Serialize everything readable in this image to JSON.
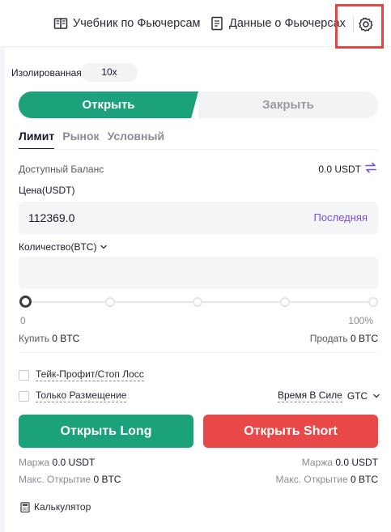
{
  "header": {
    "tutorial_label": "Учебник по Фьючерсам",
    "data_label": "Данные о Фьючерсах"
  },
  "margin": {
    "mode_label": "Изолированная",
    "leverage": "10x"
  },
  "side": {
    "open_label": "Открыть",
    "close_label": "Закрыть"
  },
  "order_tabs": [
    "Лимит",
    "Рынок",
    "Условный"
  ],
  "balance": {
    "label": "Доступный Баланс",
    "value": "0.0 USDT"
  },
  "price": {
    "label": "Цена(USDT)",
    "value": "112369.0",
    "last_label": "Последняя"
  },
  "quantity": {
    "label": "Количество(BTC)",
    "value": ""
  },
  "slider": {
    "min_label": "0",
    "max_label": "100%",
    "level": 0
  },
  "buy_sell": {
    "buy_label": "Купить",
    "buy_value": "0 BTC",
    "sell_label": "Продать",
    "sell_value": "0 BTC"
  },
  "options": {
    "tp_sl_label": "Тейк-Профит/Стоп Лосс",
    "post_only_label": "Только Размещение",
    "tif_label": "Время В Силе",
    "tif_value": "GTC"
  },
  "actions": {
    "long_label": "Открыть Long",
    "short_label": "Открыть Short"
  },
  "long_info": {
    "margin_label": "Маржа",
    "margin_value": "0.0 USDT",
    "max_open_label": "Макс. Открытие",
    "max_open_value": "0 BTC"
  },
  "short_info": {
    "margin_label": "Маржа",
    "margin_value": "0.0 USDT",
    "max_open_label": "Макс. Открытие",
    "max_open_value": "0 BTC"
  },
  "calculator_label": "Калькулятор",
  "colors": {
    "buy_green": "#1ba27a",
    "sell_red": "#e84848",
    "accent_purple": "#7b4ce0",
    "highlight_red": "#e8433f"
  }
}
